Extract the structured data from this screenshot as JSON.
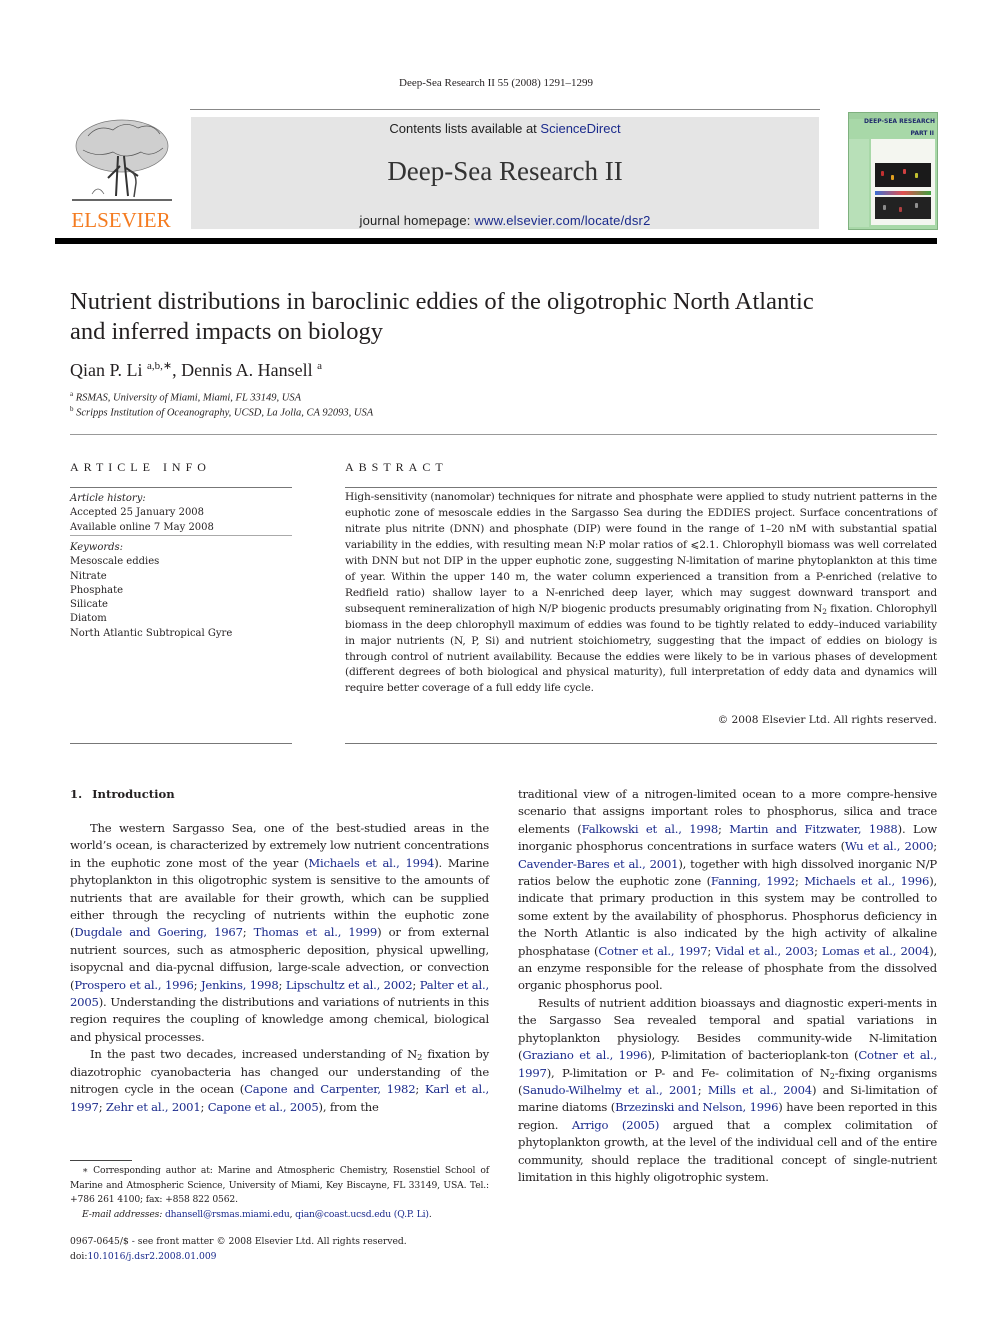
{
  "header": {
    "running_head": "Deep-Sea Research II 55 (2008) 1291–1299",
    "contents_prefix": "Contents lists available at ",
    "contents_link": "ScienceDirect",
    "journal_name": "Deep-Sea Research II",
    "homepage_prefix": "journal homepage: ",
    "homepage_link": "www.elsevier.com/locate/dsr2",
    "publisher_logo_text": "ELSEVIER",
    "cover": {
      "title": "DEEP-SEA RESEARCH",
      "part": "PART II"
    },
    "colors": {
      "elsevier_orange": "#f47b20",
      "link_blue": "#1a2a8c",
      "banner_gray": "#e5e5e5",
      "cover_green": "#a8d8a8"
    }
  },
  "article": {
    "title_line1": "Nutrient distributions in baroclinic eddies of the oligotrophic North Atlantic",
    "title_line2": "and inferred impacts on biology",
    "authors": [
      {
        "name": "Qian P. Li",
        "sup": "a,b,∗"
      },
      {
        "name": "Dennis A. Hansell",
        "sup": "a"
      }
    ],
    "author_separator": ", ",
    "affiliations": [
      {
        "mark": "a",
        "text": "RSMAS, University of Miami, Miami, FL 33149, USA"
      },
      {
        "mark": "b",
        "text": "Scripps Institution of Oceanography, UCSD, La Jolla, CA 92093, USA"
      }
    ]
  },
  "article_info": {
    "heading": "ARTICLE INFO",
    "history_label": "Article history:",
    "history": [
      "Accepted 25 January 2008",
      "Available online 7 May 2008"
    ],
    "keywords_label": "Keywords:",
    "keywords": [
      "Mesoscale eddies",
      "Nitrate",
      "Phosphate",
      "Silicate",
      "Diatom",
      "North Atlantic Subtropical Gyre"
    ]
  },
  "abstract": {
    "heading": "ABSTRACT",
    "segments": [
      {
        "t": "High-sensitivity (nanomolar) techniques for nitrate and phosphate were applied to study nutrient patterns in the euphotic zone of mesoscale eddies in the Sargasso Sea during the EDDIES project. Surface concentrations of nitrate plus nitrite (DNN) and phosphate (DIP) were found in the range of 1–20 nM with substantial spatial variability in the eddies, with resulting mean N:P molar ratios of ⩽2.1. Chlorophyll biomass was well correlated with DNN but not DIP in the upper euphotic zone, suggesting N-limitation of marine phytoplankton at this time of year. Within the upper 140 m, the water column experienced a transition from a P-enriched (relative to Redfield ratio) shallow layer to a N-enriched deep layer, which may suggest downward transport and subsequent remineralization of high N/P biogenic products presumably originating from N"
      },
      {
        "t": "2",
        "sub": true
      },
      {
        "t": " fixation. Chlorophyll biomass in the deep chlorophyll maximum of eddies was found to be tightly related to eddy–induced variability in major nutrients (N, P, Si) and nutrient stoichiometry, suggesting that the impact of eddies on biology is through control of nutrient availability. Because the eddies were likely to be in various phases of development (different degrees of both biological and physical maturity), full interpretation of eddy data and dynamics will require better coverage of a full eddy life cycle."
      }
    ],
    "copyright": "© 2008 Elsevier Ltd. All rights reserved."
  },
  "introduction": {
    "number": "1.",
    "heading": "Introduction",
    "left_paragraphs": [
      [
        {
          "t": "The western Sargasso Sea, one of the best-studied areas in the world’s ocean, is characterized by extremely low nutrient concentrations in the euphotic zone most of the year ("
        },
        {
          "t": "Michaels et al., 1994",
          "link": true
        },
        {
          "t": "). Marine phytoplankton in this oligotrophic system is sensitive to the amounts of nutrients that are available for their growth, which can be supplied either through the recycling of nutrients within the euphotic zone ("
        },
        {
          "t": "Dugdale and Goering, 1967",
          "link": true
        },
        {
          "t": "; "
        },
        {
          "t": "Thomas et al., 1999",
          "link": true
        },
        {
          "t": ") or from external nutrient sources, such as atmospheric deposition, physical upwelling, isopycnal and dia-pycnal diffusion, large-scale advection, or convection ("
        },
        {
          "t": "Prospero et al., 1996",
          "link": true
        },
        {
          "t": "; "
        },
        {
          "t": "Jenkins, 1998",
          "link": true
        },
        {
          "t": "; "
        },
        {
          "t": "Lipschultz et al., 2002",
          "link": true
        },
        {
          "t": "; "
        },
        {
          "t": "Palter et al., 2005",
          "link": true
        },
        {
          "t": "). Understanding the distributions and variations of nutrients in this region requires the coupling of knowledge among chemical, biological and physical processes."
        }
      ],
      [
        {
          "t": "In the past two decades, increased understanding of N"
        },
        {
          "t": "2",
          "sub": true
        },
        {
          "t": " fixation by diazotrophic cyanobacteria has changed our understanding of the nitrogen cycle in the ocean ("
        },
        {
          "t": "Capone and Carpenter, 1982",
          "link": true
        },
        {
          "t": "; "
        },
        {
          "t": "Karl et al., 1997",
          "link": true
        },
        {
          "t": "; "
        },
        {
          "t": "Zehr et al., 2001",
          "link": true
        },
        {
          "t": "; "
        },
        {
          "t": "Capone et al., 2005",
          "link": true
        },
        {
          "t": "), from the"
        }
      ]
    ],
    "right_paragraphs": [
      [
        {
          "t": "traditional view of a nitrogen-limited ocean to a more compre-hensive scenario that assigns important roles to phosphorus, silica and trace elements ("
        },
        {
          "t": "Falkowski et al., 1998",
          "link": true
        },
        {
          "t": "; "
        },
        {
          "t": "Martin and Fitzwater, 1988",
          "link": true
        },
        {
          "t": "). Low inorganic phosphorus concentrations in surface waters ("
        },
        {
          "t": "Wu et al., 2000",
          "link": true
        },
        {
          "t": "; "
        },
        {
          "t": "Cavender-Bares et al., 2001",
          "link": true
        },
        {
          "t": "), together with high dissolved inorganic N/P ratios below the euphotic zone ("
        },
        {
          "t": "Fanning, 1992",
          "link": true
        },
        {
          "t": "; "
        },
        {
          "t": "Michaels et al., 1996",
          "link": true
        },
        {
          "t": "), indicate that primary production in this system may be controlled to some extent by the availability of phosphorus. Phosphorus deficiency in the North Atlantic is also indicated by the high activity of alkaline phosphatase ("
        },
        {
          "t": "Cotner et al., 1997",
          "link": true
        },
        {
          "t": "; "
        },
        {
          "t": "Vidal et al., 2003",
          "link": true
        },
        {
          "t": "; "
        },
        {
          "t": "Lomas et al., 2004",
          "link": true
        },
        {
          "t": "), an enzyme responsible for the release of phosphate from the dissolved organic phosphorus pool."
        }
      ],
      [
        {
          "t": "Results of nutrient addition bioassays and diagnostic experi-ments in the Sargasso Sea revealed temporal and spatial variations in phytoplankton physiology. Besides community-wide N-limitation ("
        },
        {
          "t": "Graziano et al., 1996",
          "link": true
        },
        {
          "t": "), P-limitation of bacterioplank-ton ("
        },
        {
          "t": "Cotner et al., 1997",
          "link": true
        },
        {
          "t": "), P-limitation or P- and Fe- colimitation of N"
        },
        {
          "t": "2",
          "sub": true
        },
        {
          "t": "-fixing organisms ("
        },
        {
          "t": "Sanudo-Wilhelmy et al., 2001",
          "link": true
        },
        {
          "t": "; "
        },
        {
          "t": "Mills et al., 2004",
          "link": true
        },
        {
          "t": ") and Si-limitation of marine diatoms ("
        },
        {
          "t": "Brzezinski and Nelson, 1996",
          "link": true
        },
        {
          "t": ") have been reported in this region. "
        },
        {
          "t": "Arrigo (2005)",
          "link": true
        },
        {
          "t": " argued that a complex colimitation of phytoplankton growth, at the level of the individual cell and of the entire community, should replace the traditional concept of single-nutrient limitation in this highly oligotrophic system."
        }
      ]
    ]
  },
  "footnote": {
    "corresponding": "∗ Corresponding author at: Marine and Atmospheric Chemistry, Rosenstiel School of Marine and Atmospheric Science, University of Miami, Key Biscayne, FL 33149, USA. Tel.: +786 261 4100; fax: +858 822 0562.",
    "email_label": "E-mail addresses: ",
    "emails": [
      "dhansell@rsmas.miami.edu",
      "qian@coast.ucsd.edu (Q.P. Li)"
    ],
    "email_end": "."
  },
  "front_matter": {
    "issn_line": "0967-0645/$ - see front matter © 2008 Elsevier Ltd. All rights reserved.",
    "doi_prefix": "doi:",
    "doi": "10.1016/j.dsr2.2008.01.009"
  }
}
